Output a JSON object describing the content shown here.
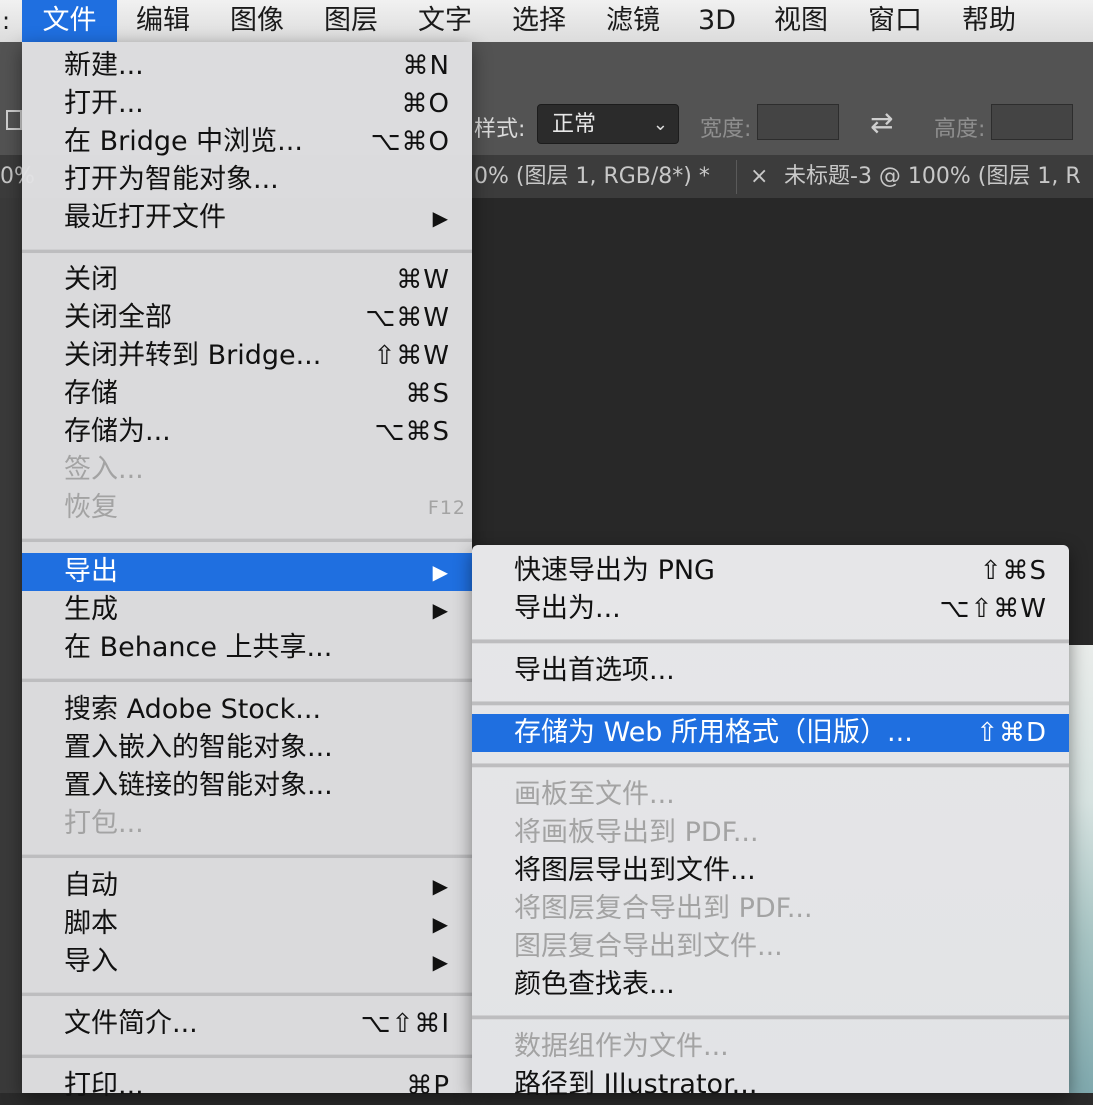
{
  "menubar": {
    "items": [
      {
        "label": "文件",
        "active": true
      },
      {
        "label": "编辑"
      },
      {
        "label": "图像"
      },
      {
        "label": "图层"
      },
      {
        "label": "文字"
      },
      {
        "label": "选择"
      },
      {
        "label": "滤镜"
      },
      {
        "label": "3D"
      },
      {
        "label": "视图"
      },
      {
        "label": "窗口"
      },
      {
        "label": "帮助"
      }
    ],
    "left_edge_glyph": ":"
  },
  "options_bar": {
    "style_label": "样式:",
    "style_value": "正常",
    "width_label": "宽度:",
    "height_label": "高度:",
    "icons": [
      "marquee-tool-icon",
      "swap-icon",
      "chevron-down-icon"
    ]
  },
  "tabs": {
    "left_fragment": "0%",
    "tab1_text": "0% (图层 1, RGB/8*) *",
    "tab2_close": "×",
    "tab2_text": "未标题-3 @ 100% (图层 1, R"
  },
  "file_menu": {
    "new": {
      "label": "新建...",
      "shortcut": "⌘N"
    },
    "open": {
      "label": "打开...",
      "shortcut": "⌘O"
    },
    "browse_bridge": {
      "label": "在 Bridge 中浏览...",
      "shortcut": "⌥⌘O"
    },
    "open_smart": {
      "label": "打开为智能对象..."
    },
    "recent": {
      "label": "最近打开文件",
      "arrow": "▶"
    },
    "close": {
      "label": "关闭",
      "shortcut": "⌘W"
    },
    "close_all": {
      "label": "关闭全部",
      "shortcut": "⌥⌘W"
    },
    "close_bridge": {
      "label": "关闭并转到 Bridge...",
      "shortcut": "⇧⌘W"
    },
    "save": {
      "label": "存储",
      "shortcut": "⌘S"
    },
    "save_as": {
      "label": "存储为...",
      "shortcut": "⌥⌘S"
    },
    "check_in": {
      "label": "签入..."
    },
    "revert": {
      "label": "恢复",
      "shortcut": "F12"
    },
    "export": {
      "label": "导出",
      "arrow": "▶"
    },
    "generate": {
      "label": "生成",
      "arrow": "▶"
    },
    "behance": {
      "label": "在 Behance 上共享..."
    },
    "adobe_stock": {
      "label": "搜索 Adobe Stock..."
    },
    "place_embedded": {
      "label": "置入嵌入的智能对象..."
    },
    "place_linked": {
      "label": "置入链接的智能对象..."
    },
    "package": {
      "label": "打包..."
    },
    "automate": {
      "label": "自动",
      "arrow": "▶"
    },
    "scripts": {
      "label": "脚本",
      "arrow": "▶"
    },
    "import": {
      "label": "导入",
      "arrow": "▶"
    },
    "file_info": {
      "label": "文件简介...",
      "shortcut": "⌥⇧⌘I"
    },
    "print": {
      "label": "打印...",
      "shortcut": "⌘P"
    }
  },
  "export_submenu": {
    "quick_png": {
      "label": "快速导出为 PNG",
      "shortcut": "⇧⌘S"
    },
    "export_as": {
      "label": "导出为...",
      "shortcut": "⌥⇧⌘W"
    },
    "prefs": {
      "label": "导出首选项..."
    },
    "save_web": {
      "label": "存储为 Web 所用格式（旧版）...",
      "shortcut": "⇧⌘D"
    },
    "artboards_files": {
      "label": "画板至文件..."
    },
    "artboards_pdf": {
      "label": "将画板导出到 PDF..."
    },
    "layers_files": {
      "label": "将图层导出到文件..."
    },
    "comps_pdf": {
      "label": "将图层复合导出到 PDF..."
    },
    "comps_files": {
      "label": "图层复合导出到文件..."
    },
    "color_lookup": {
      "label": "颜色查找表..."
    },
    "data_sets": {
      "label": "数据组作为文件..."
    },
    "paths_illustrator": {
      "label": "路径到 Illustrator..."
    }
  },
  "colors": {
    "highlight": "#1f6fe0",
    "menu_bg": "#e2e2e4",
    "disabled_text": "#a3a3a3"
  }
}
